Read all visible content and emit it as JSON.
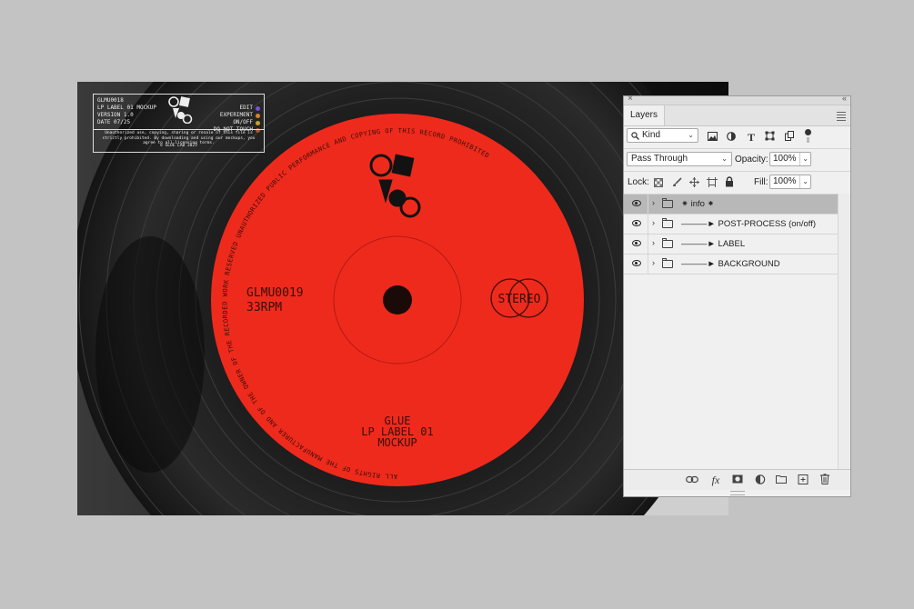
{
  "info_box": {
    "lines": [
      "GLMU0018",
      "LP LABEL 01 MOCKUP",
      "VERSION 1.0",
      "DATE 07/25"
    ],
    "legend": [
      {
        "label": "EDIT",
        "color": "#7a4fd1"
      },
      {
        "label": "EXPERIMENT",
        "color": "#d9822b"
      },
      {
        "label": "ON/OFF",
        "color": "#c9a227"
      },
      {
        "label": "DO NOT TOUCH",
        "color": "#b5531c"
      }
    ],
    "notice": "Unauthorized use, copying, sharing or resale of this file is strictly prohibited. By downloading and using our mockups, you agree to all licensing terms.",
    "copyright": "© GLUE LAB 2025"
  },
  "record": {
    "label_color": "#ee2a1c",
    "catalog": "GLMU0019",
    "speed": "33RPM",
    "stereo": "STEREO",
    "title_lines": [
      "GLUE",
      "LP LABEL 01",
      "MOCKUP"
    ],
    "rim_text": "ALL RIGHTS OF THE MANUFACTURER AND OF THE OWNER OF THE RECORDED WORK RESERVED UNAUTHORIZED PUBLIC PERFORMANCE AND COPYING OF THIS RECORD PROHIBITED"
  },
  "panel": {
    "tab": "Layers",
    "filter": {
      "label": "Kind"
    },
    "blend_mode": "Pass Through",
    "opacity_label": "Opacity:",
    "opacity_value": "100%",
    "lock_label": "Lock:",
    "fill_label": "Fill:",
    "fill_value": "100%",
    "layers": [
      {
        "name": "⁕ info ⁕",
        "selected": true
      },
      {
        "name": "———► POST-PROCESS (on/off)",
        "selected": false
      },
      {
        "name": "———► LABEL",
        "selected": false
      },
      {
        "name": "———► BACKGROUND",
        "selected": false
      }
    ]
  }
}
